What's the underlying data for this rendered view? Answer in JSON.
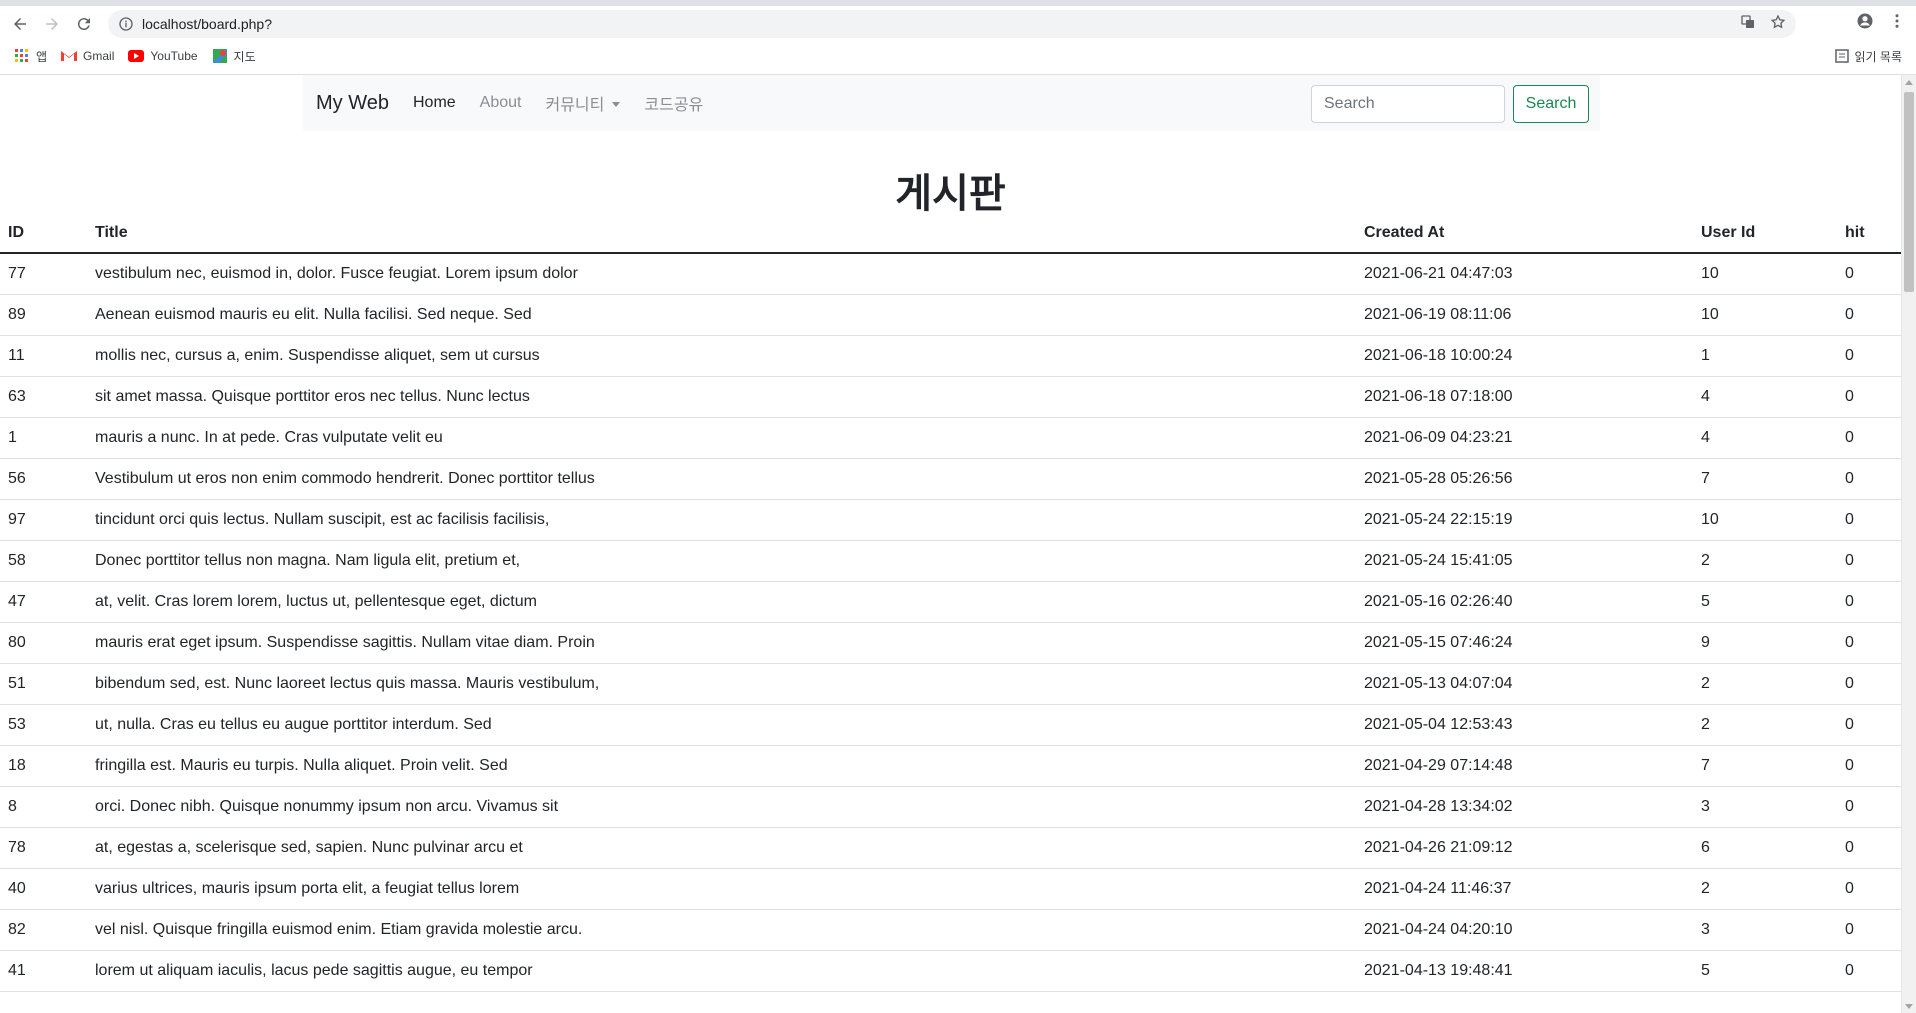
{
  "browser": {
    "url": "localhost/board.php?",
    "bookmarks": [
      {
        "label": "앱",
        "icon": "apps-grid-icon"
      },
      {
        "label": "Gmail",
        "icon": "gmail-icon"
      },
      {
        "label": "YouTube",
        "icon": "youtube-icon"
      },
      {
        "label": "지도",
        "icon": "maps-icon"
      }
    ],
    "reading_list": "읽기 목록"
  },
  "navbar": {
    "brand": "My Web",
    "links": [
      {
        "label": "Home",
        "active": true
      },
      {
        "label": "About",
        "active": false
      },
      {
        "label": "커뮤니티",
        "active": false,
        "dropdown": true
      },
      {
        "label": "코드공유",
        "active": false
      }
    ],
    "search_placeholder": "Search",
    "search_button": "Search"
  },
  "page": {
    "title": "게시판"
  },
  "table": {
    "headers": [
      "ID",
      "Title",
      "Created At",
      "User Id",
      "hit"
    ],
    "rows": [
      [
        "77",
        "vestibulum nec, euismod in, dolor. Fusce feugiat. Lorem ipsum dolor",
        "2021-06-21 04:47:03",
        "10",
        "0"
      ],
      [
        "89",
        "Aenean euismod mauris eu elit. Nulla facilisi. Sed neque. Sed",
        "2021-06-19 08:11:06",
        "10",
        "0"
      ],
      [
        "11",
        "mollis nec, cursus a, enim. Suspendisse aliquet, sem ut cursus",
        "2021-06-18 10:00:24",
        "1",
        "0"
      ],
      [
        "63",
        "sit amet massa. Quisque porttitor eros nec tellus. Nunc lectus",
        "2021-06-18 07:18:00",
        "4",
        "0"
      ],
      [
        "1",
        "mauris a nunc. In at pede. Cras vulputate velit eu",
        "2021-06-09 04:23:21",
        "4",
        "0"
      ],
      [
        "56",
        "Vestibulum ut eros non enim commodo hendrerit. Donec porttitor tellus",
        "2021-05-28 05:26:56",
        "7",
        "0"
      ],
      [
        "97",
        "tincidunt orci quis lectus. Nullam suscipit, est ac facilisis facilisis,",
        "2021-05-24 22:15:19",
        "10",
        "0"
      ],
      [
        "58",
        "Donec porttitor tellus non magna. Nam ligula elit, pretium et,",
        "2021-05-24 15:41:05",
        "2",
        "0"
      ],
      [
        "47",
        "at, velit. Cras lorem lorem, luctus ut, pellentesque eget, dictum",
        "2021-05-16 02:26:40",
        "5",
        "0"
      ],
      [
        "80",
        "mauris erat eget ipsum. Suspendisse sagittis. Nullam vitae diam. Proin",
        "2021-05-15 07:46:24",
        "9",
        "0"
      ],
      [
        "51",
        "bibendum sed, est. Nunc laoreet lectus quis massa. Mauris vestibulum,",
        "2021-05-13 04:07:04",
        "2",
        "0"
      ],
      [
        "53",
        "ut, nulla. Cras eu tellus eu augue porttitor interdum. Sed",
        "2021-05-04 12:53:43",
        "2",
        "0"
      ],
      [
        "18",
        "fringilla est. Mauris eu turpis. Nulla aliquet. Proin velit. Sed",
        "2021-04-29 07:14:48",
        "7",
        "0"
      ],
      [
        "8",
        "orci. Donec nibh. Quisque nonummy ipsum non arcu. Vivamus sit",
        "2021-04-28 13:34:02",
        "3",
        "0"
      ],
      [
        "78",
        "at, egestas a, scelerisque sed, sapien. Nunc pulvinar arcu et",
        "2021-04-26 21:09:12",
        "6",
        "0"
      ],
      [
        "40",
        "varius ultrices, mauris ipsum porta elit, a feugiat tellus lorem",
        "2021-04-24 11:46:37",
        "2",
        "0"
      ],
      [
        "82",
        "vel nisl. Quisque fringilla euismod enim. Etiam gravida molestie arcu.",
        "2021-04-24 04:20:10",
        "3",
        "0"
      ],
      [
        "41",
        "lorem ut aliquam iaculis, lacus pede sagittis augue, eu tempor",
        "2021-04-13 19:48:41",
        "5",
        "0"
      ]
    ]
  },
  "colors": {
    "navbar_bg": "#f8f9fa",
    "search_button": "#198754",
    "text": "#212529",
    "muted_link": "#8a8f94"
  }
}
